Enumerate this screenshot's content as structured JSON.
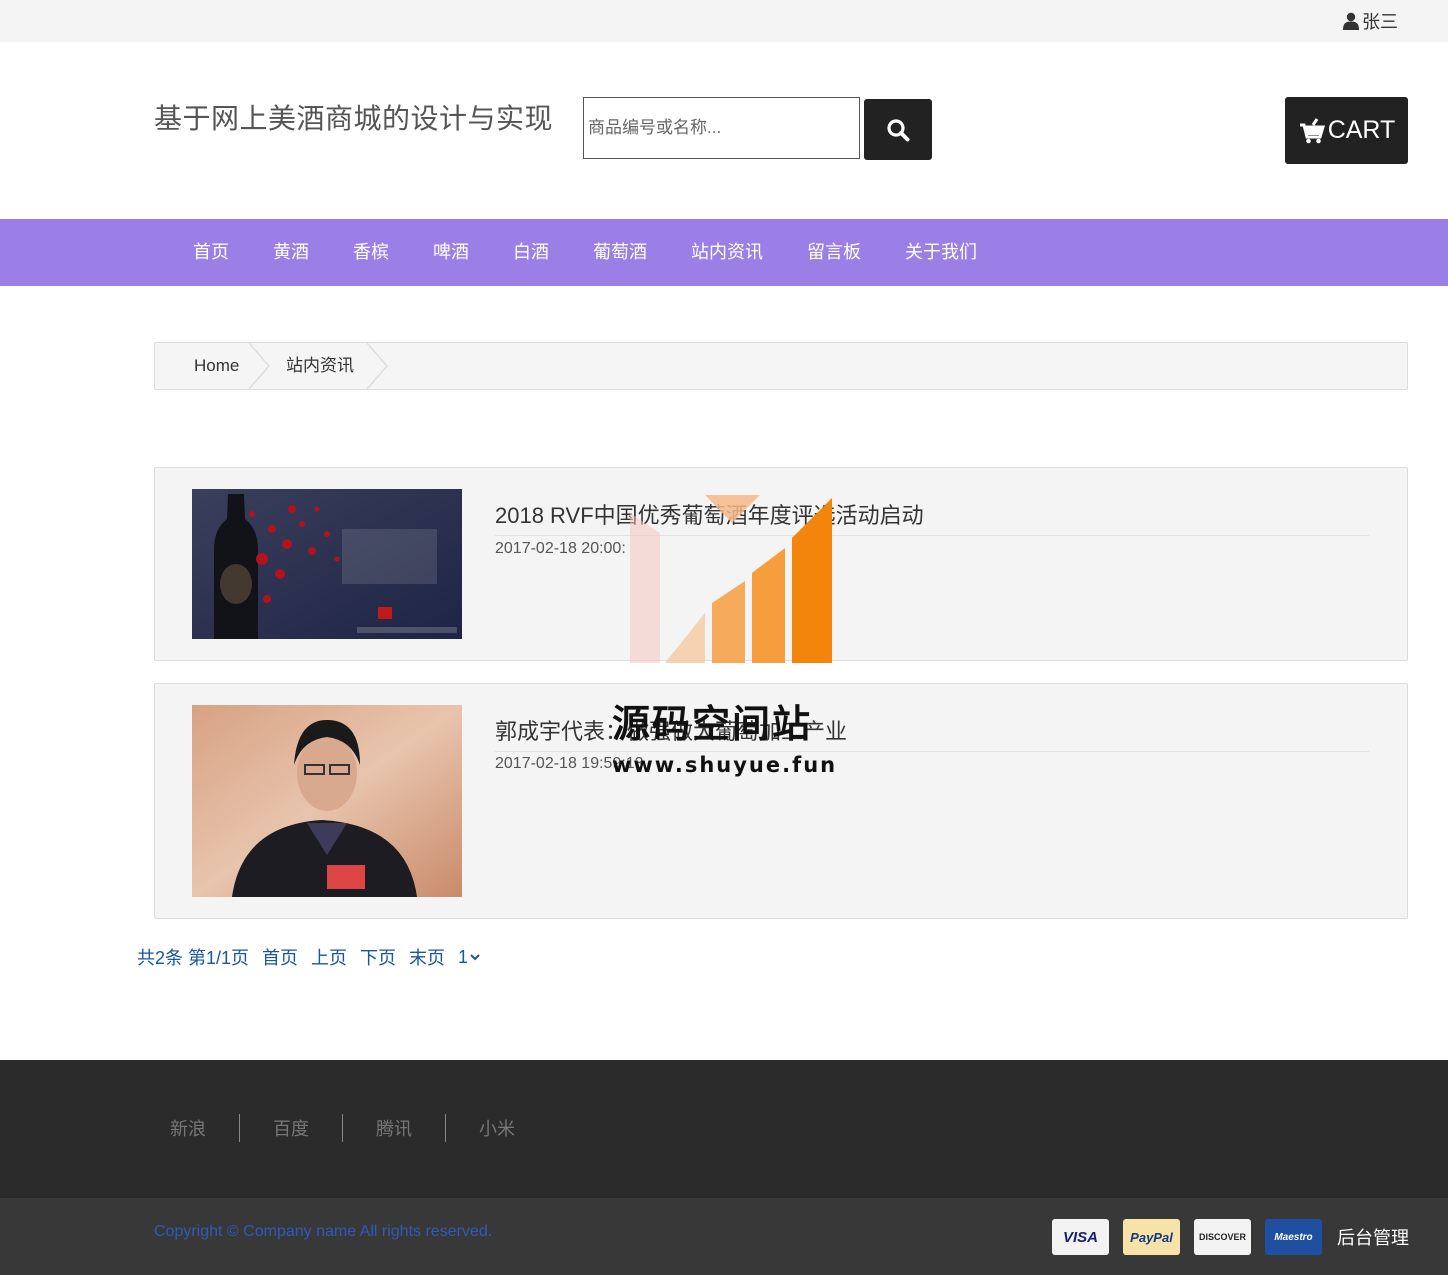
{
  "topbar": {
    "user_name": "张三",
    "user_icon": "user-icon"
  },
  "header": {
    "site_title": "基于网上美酒商城的设计与实现",
    "search_placeholder": "商品编号或名称...",
    "search_icon": "search-icon",
    "cart_label": "CART",
    "cart_icon": "cart-icon"
  },
  "nav": {
    "items": [
      "首页",
      "黄酒",
      "香槟",
      "啤酒",
      "白酒",
      "葡萄酒",
      "站内资讯",
      "留言板",
      "关于我们"
    ]
  },
  "breadcrumb": {
    "home": "Home",
    "current": "站内资讯"
  },
  "news": [
    {
      "title": "2018 RVF中国优秀葡萄酒年度评选活动启动",
      "date": "2017-02-18 20:00:"
    },
    {
      "title": "郭成宇代表：做强做大葡萄加工产业",
      "date": "2017-02-18 19:59:13"
    }
  ],
  "pagination": {
    "summary": "共2条 第1/1页",
    "first": "首页",
    "prev": "上页",
    "next": "下页",
    "last": "末页",
    "page_select": "1"
  },
  "footer": {
    "links": [
      "新浪",
      "百度",
      "腾讯",
      "小米"
    ],
    "copyright": "Copyright © Company name All rights reserved.",
    "payment_cards": [
      "VISA",
      "PayPal",
      "DISCOVER",
      "Maestro"
    ],
    "admin_link": "后台管理"
  },
  "watermark": {
    "text": "源码空间站",
    "url": "www.shuyue.fun"
  },
  "colors": {
    "nav_bg": "#9b7fe6",
    "footer_top": "#2b2b2b",
    "footer_bottom": "#383838",
    "link_blue": "#1a56a0"
  }
}
